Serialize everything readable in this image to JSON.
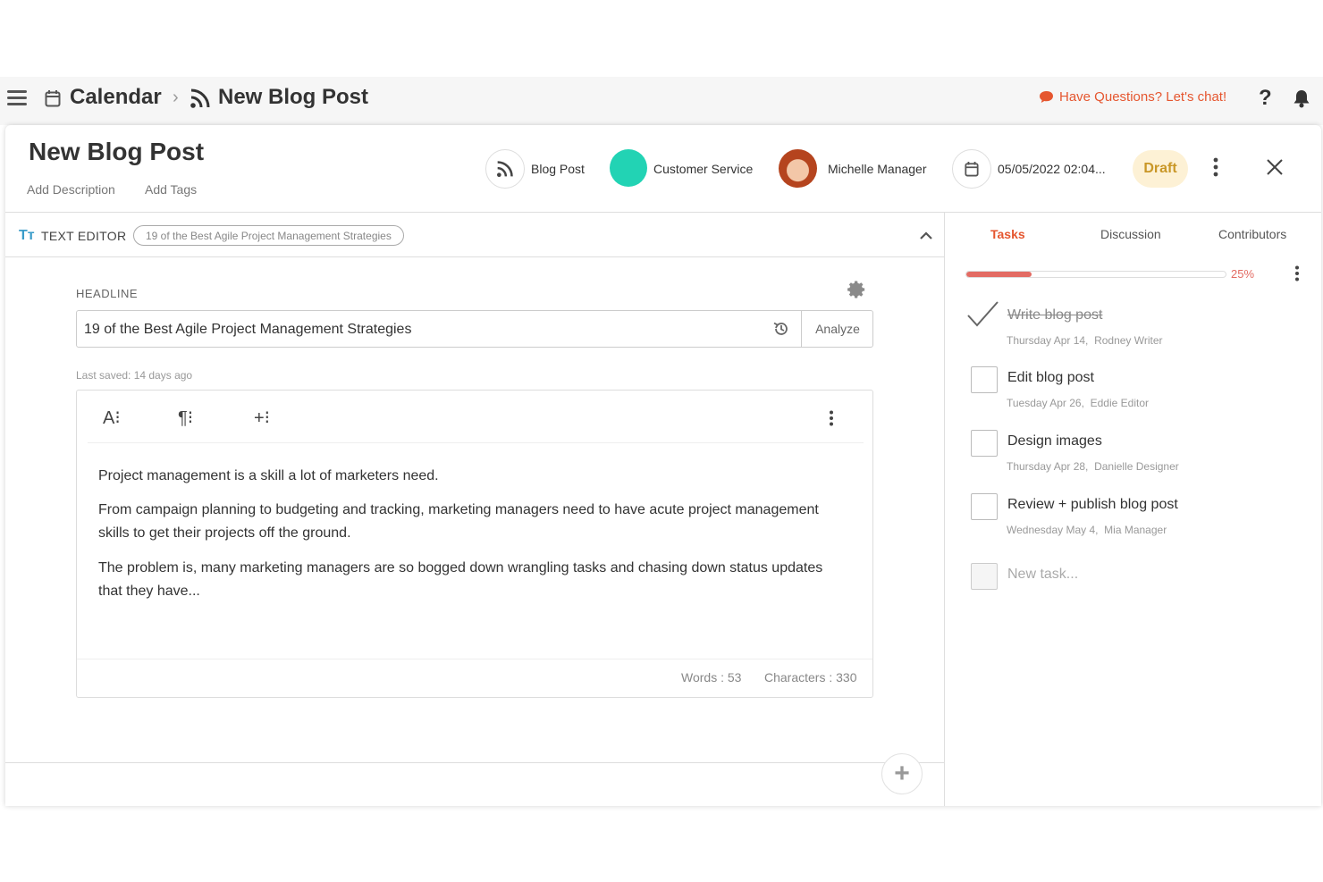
{
  "topbar": {
    "crumb_calendar": "Calendar",
    "crumb_current": "New Blog Post",
    "chat_link": "Have Questions? Let's chat!",
    "help": "?"
  },
  "header": {
    "title": "New Blog Post",
    "add_description": "Add Description",
    "add_tags": "Add Tags",
    "type_label": "Blog Post",
    "team_label": "Customer Service",
    "team_color": "#22d3b4",
    "owner_label": "Michelle Manager",
    "date_label": "05/05/2022 02:04...",
    "status_label": "Draft"
  },
  "text_editor": {
    "section_label": "TEXT EDITOR",
    "pill": "19 of the Best Agile Project Management Strategies",
    "headline_label": "HEADLINE",
    "headline_value": "19 of the Best Agile Project Management Strategies",
    "analyze": "Analyze",
    "last_saved": "Last saved: 14 days ago",
    "toolbar": {
      "text_style": "A⁝",
      "paragraph": "¶⁝",
      "insert": "+⁝"
    },
    "paragraphs": [
      "Project management is a skill a lot of marketers need.",
      "From campaign planning to budgeting and tracking, marketing managers need to have acute project management skills to get their projects off the ground.",
      "The problem is, many marketing managers are so bogged down wrangling tasks and chasing down status updates that they have..."
    ],
    "words": "Words : 53",
    "characters": "Characters : 330"
  },
  "panel": {
    "tabs": [
      "Tasks",
      "Discussion",
      "Contributors"
    ],
    "active_tab": "Tasks",
    "progress_fraction": 0.25,
    "progress_label": "25%",
    "accent_color": "#e5562f",
    "tasks": [
      {
        "title": "Write blog post",
        "date": "Thursday Apr 14,",
        "assignee": "Rodney Writer",
        "done": true
      },
      {
        "title": "Edit blog post",
        "date": "Tuesday Apr 26,",
        "assignee": "Eddie Editor",
        "done": false
      },
      {
        "title": "Design images",
        "date": "Thursday Apr 28,",
        "assignee": "Danielle Designer",
        "done": false
      },
      {
        "title": "Review + publish blog post",
        "date": "Wednesday May 4,",
        "assignee": "Mia Manager",
        "done": false
      }
    ],
    "new_task_placeholder": "New task..."
  }
}
